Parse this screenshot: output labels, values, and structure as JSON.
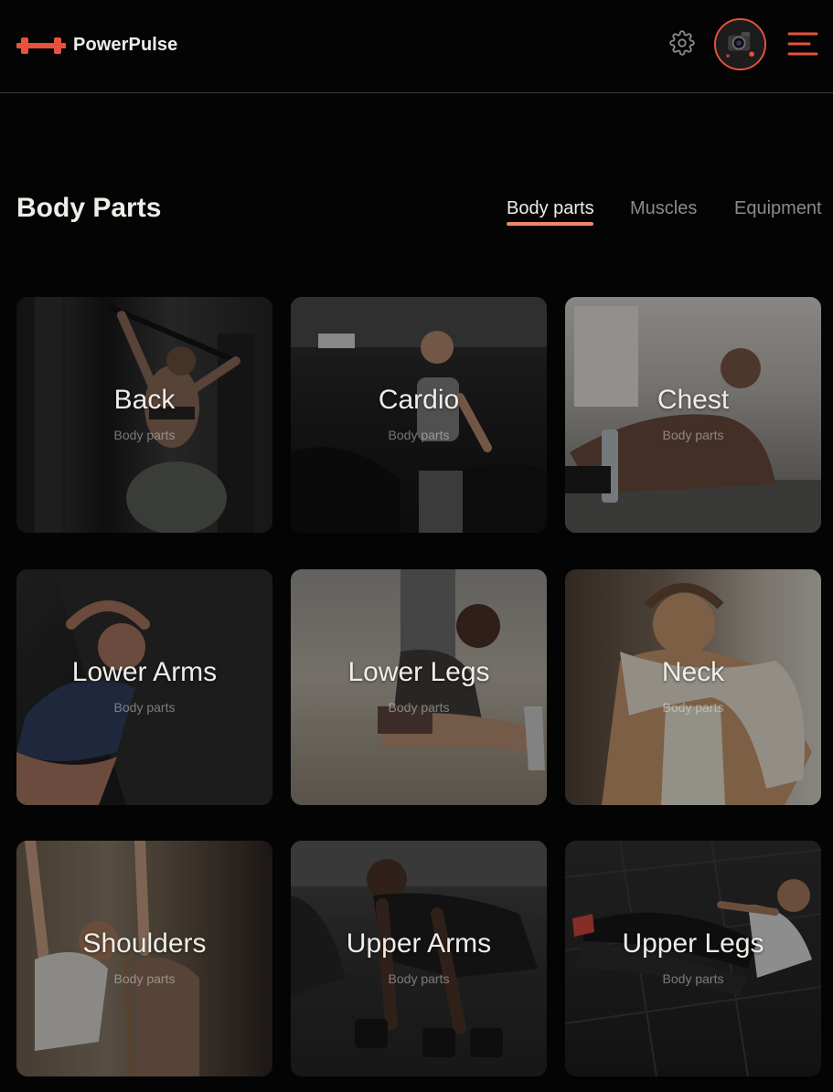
{
  "header": {
    "brand": "PowerPulse",
    "icons": [
      "dumbbell-icon",
      "gear-icon",
      "avatar",
      "hamburger-icon"
    ],
    "accent_color": "#e6533c"
  },
  "page": {
    "title": "Body Parts",
    "tabs": [
      {
        "label": "Body parts",
        "active": true
      },
      {
        "label": "Muscles",
        "active": false
      },
      {
        "label": "Equipment",
        "active": false
      }
    ]
  },
  "cards": [
    {
      "name": "Back",
      "subtitle": "Body parts"
    },
    {
      "name": "Cardio",
      "subtitle": "Body parts"
    },
    {
      "name": "Chest",
      "subtitle": "Body parts"
    },
    {
      "name": "Lower Arms",
      "subtitle": "Body parts"
    },
    {
      "name": "Lower Legs",
      "subtitle": "Body parts"
    },
    {
      "name": "Neck",
      "subtitle": "Body parts"
    },
    {
      "name": "Shoulders",
      "subtitle": "Body parts"
    },
    {
      "name": "Upper Arms",
      "subtitle": "Body parts"
    },
    {
      "name": "Upper Legs",
      "subtitle": "Body parts"
    }
  ]
}
